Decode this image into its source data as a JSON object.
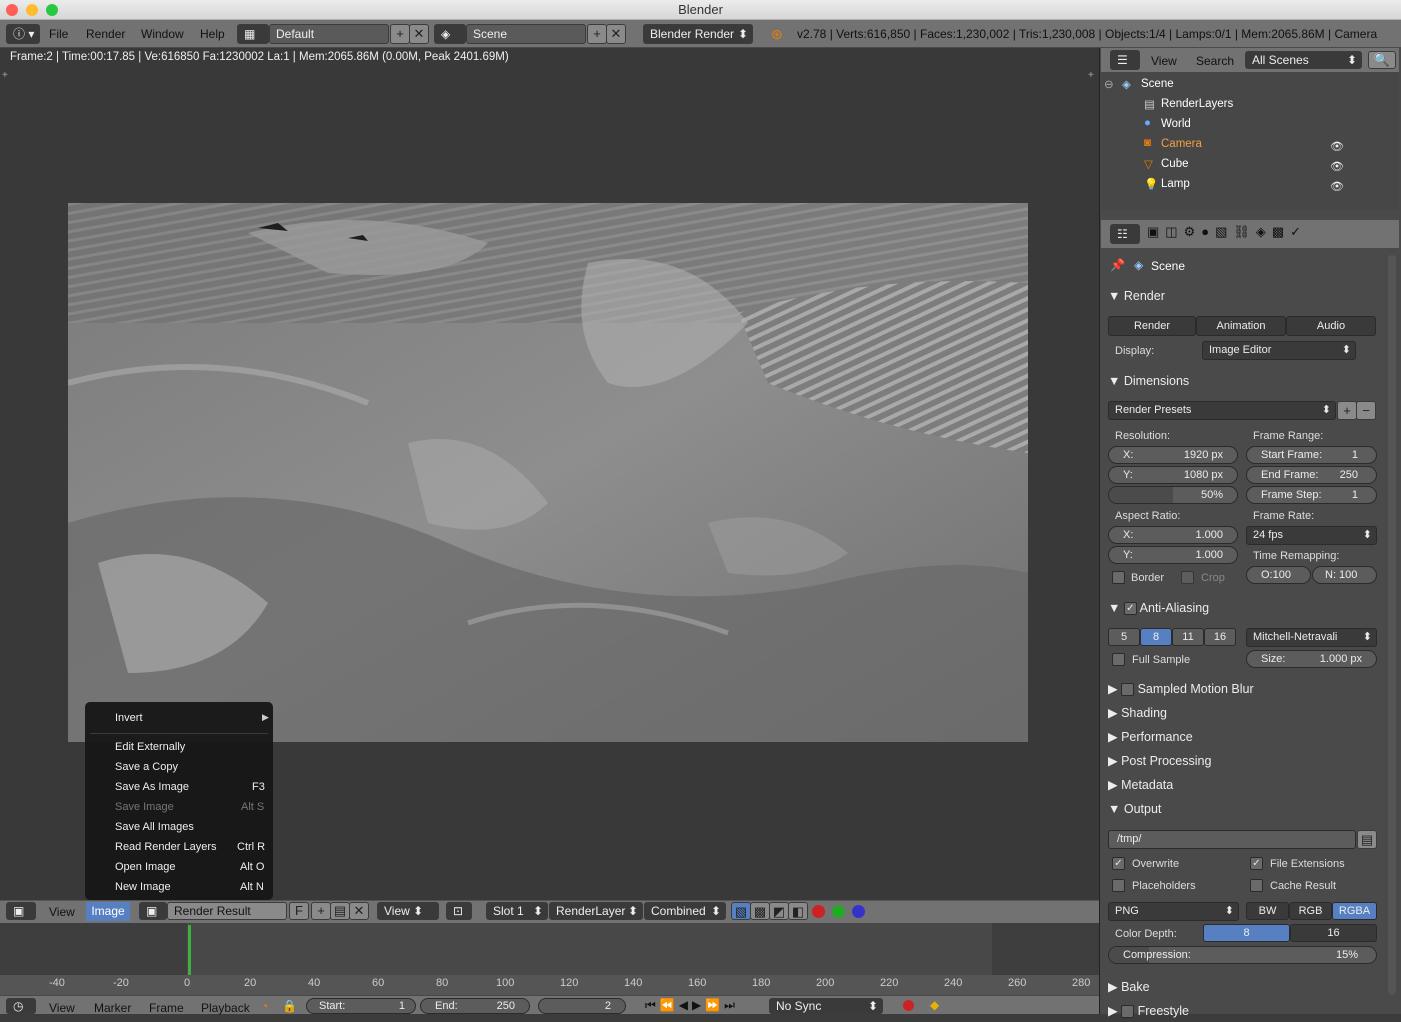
{
  "window": {
    "title": "Blender"
  },
  "topbar": {
    "menus": [
      "File",
      "Render",
      "Window",
      "Help"
    ],
    "layout": "Default",
    "scene": "Scene",
    "engine": "Blender Render",
    "stats": "v2.78 | Verts:616,850 | Faces:1,230,002 | Tris:1,230,008 | Objects:1/4 | Lamps:0/1 | Mem:2065.86M | Camera"
  },
  "viewport": {
    "info": "Frame:2 | Time:00:17.85 | Ve:616850 Fa:1230002 La:1 | Mem:2065.86M (0.00M, Peak 2401.69M)"
  },
  "context_menu": {
    "items": [
      {
        "label": "Invert",
        "shortcut": "",
        "disabled": false,
        "submenu": true
      },
      {
        "label": "Edit Externally",
        "shortcut": "",
        "disabled": false
      },
      {
        "label": "Save a Copy",
        "shortcut": "",
        "disabled": false
      },
      {
        "label": "Save As Image",
        "shortcut": "F3",
        "disabled": false
      },
      {
        "label": "Save Image",
        "shortcut": "Alt S",
        "disabled": true
      },
      {
        "label": "Save All Images",
        "shortcut": "",
        "disabled": false
      },
      {
        "label": "Read Render Layers",
        "shortcut": "Ctrl R",
        "disabled": false
      },
      {
        "label": "Open Image",
        "shortcut": "Alt O",
        "disabled": false
      },
      {
        "label": "New Image",
        "shortcut": "Alt N",
        "disabled": false
      }
    ]
  },
  "image_header": {
    "view": "View",
    "image": "Image",
    "image_name": "Render Result",
    "fake_user": "F",
    "view2": "View",
    "slot": "Slot 1",
    "layer": "RenderLayer",
    "pass": "Combined"
  },
  "timeline": {
    "ticks": [
      "-40",
      "-20",
      "0",
      "20",
      "40",
      "60",
      "80",
      "100",
      "120",
      "140",
      "160",
      "180",
      "200",
      "220",
      "240",
      "260",
      "280"
    ],
    "menus": [
      "View",
      "Marker",
      "Frame",
      "Playback"
    ],
    "start_label": "Start:",
    "start": "1",
    "end_label": "End:",
    "end": "250",
    "current": "2",
    "sync": "No Sync"
  },
  "outliner": {
    "menus": [
      "View",
      "Search"
    ],
    "filter": "All Scenes",
    "items": [
      "Scene",
      "RenderLayers",
      "World",
      "Camera",
      "Cube",
      "Lamp"
    ]
  },
  "properties": {
    "context": "Scene",
    "render": {
      "title": "Render",
      "render_btn": "Render",
      "animation_btn": "Animation",
      "audio_btn": "Audio",
      "display_label": "Display:",
      "display": "Image Editor"
    },
    "dimensions": {
      "title": "Dimensions",
      "presets": "Render Presets",
      "resolution_label": "Resolution:",
      "x_label": "X:",
      "x": "1920 px",
      "y_label": "Y:",
      "y": "1080 px",
      "percent": "50%",
      "frame_range_label": "Frame Range:",
      "start_label": "Start Frame:",
      "start": "1",
      "end_label": "End Frame:",
      "end": "250",
      "step_label": "Frame Step:",
      "step": "1",
      "aspect_label": "Aspect Ratio:",
      "ax": "1.000",
      "ay": "1.000",
      "frame_rate_label": "Frame Rate:",
      "fps": "24 fps",
      "remap_label": "Time Remapping:",
      "remap_old": "O:100",
      "remap_new": "N: 100",
      "border": "Border",
      "crop": "Crop"
    },
    "aa": {
      "title": "Anti-Aliasing",
      "samples": [
        "5",
        "8",
        "11",
        "16"
      ],
      "filter": "Mitchell-Netravali",
      "full_sample": "Full Sample",
      "size": "Size:",
      "size_val": "1.000 px"
    },
    "collapsed": [
      "Sampled Motion Blur",
      "Shading",
      "Performance",
      "Post Processing",
      "Metadata"
    ],
    "output": {
      "title": "Output",
      "path": "/tmp/",
      "overwrite": "Overwrite",
      "file_ext": "File Extensions",
      "placeholders": "Placeholders",
      "cache": "Cache Result",
      "format": "PNG",
      "modes": [
        "BW",
        "RGB",
        "RGBA"
      ],
      "depth_label": "Color Depth:",
      "depths": [
        "8",
        "16"
      ],
      "compression": "Compression:",
      "compression_val": "15%"
    },
    "bake": "Bake",
    "freestyle": "Freestyle"
  }
}
